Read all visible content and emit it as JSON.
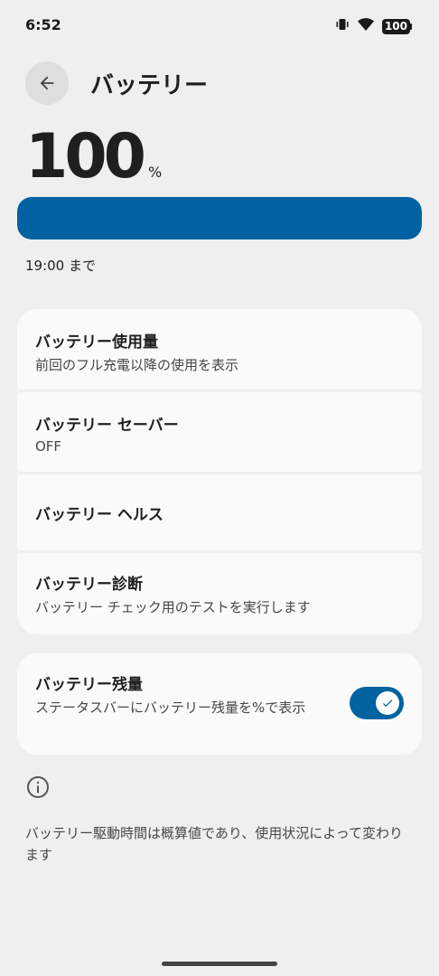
{
  "status_bar": {
    "time": "6:52",
    "battery_text": "100"
  },
  "header": {
    "title": "バッテリー"
  },
  "battery": {
    "level": "100",
    "unit": "%",
    "fill_percent": 100,
    "until": "19:00 まで"
  },
  "cards": {
    "usage": {
      "title": "バッテリー使用量",
      "subtitle": "前回のフル充電以降の使用を表示"
    },
    "saver": {
      "title": "バッテリー セーバー",
      "subtitle": "OFF"
    },
    "health": {
      "title": "バッテリー ヘルス"
    },
    "diagnostics": {
      "title": "バッテリー診断",
      "subtitle": "バッテリー チェック用のテストを実行します"
    },
    "percentage": {
      "title": "バッテリー残量",
      "subtitle": "ステータスバーにバッテリー残量を%で表示",
      "enabled": true
    }
  },
  "footer": {
    "text": "バッテリー駆動時間は概算値であり、使用状況によって変わります"
  },
  "colors": {
    "accent": "#0062a0",
    "background": "#efefef",
    "card": "#fafafa"
  }
}
